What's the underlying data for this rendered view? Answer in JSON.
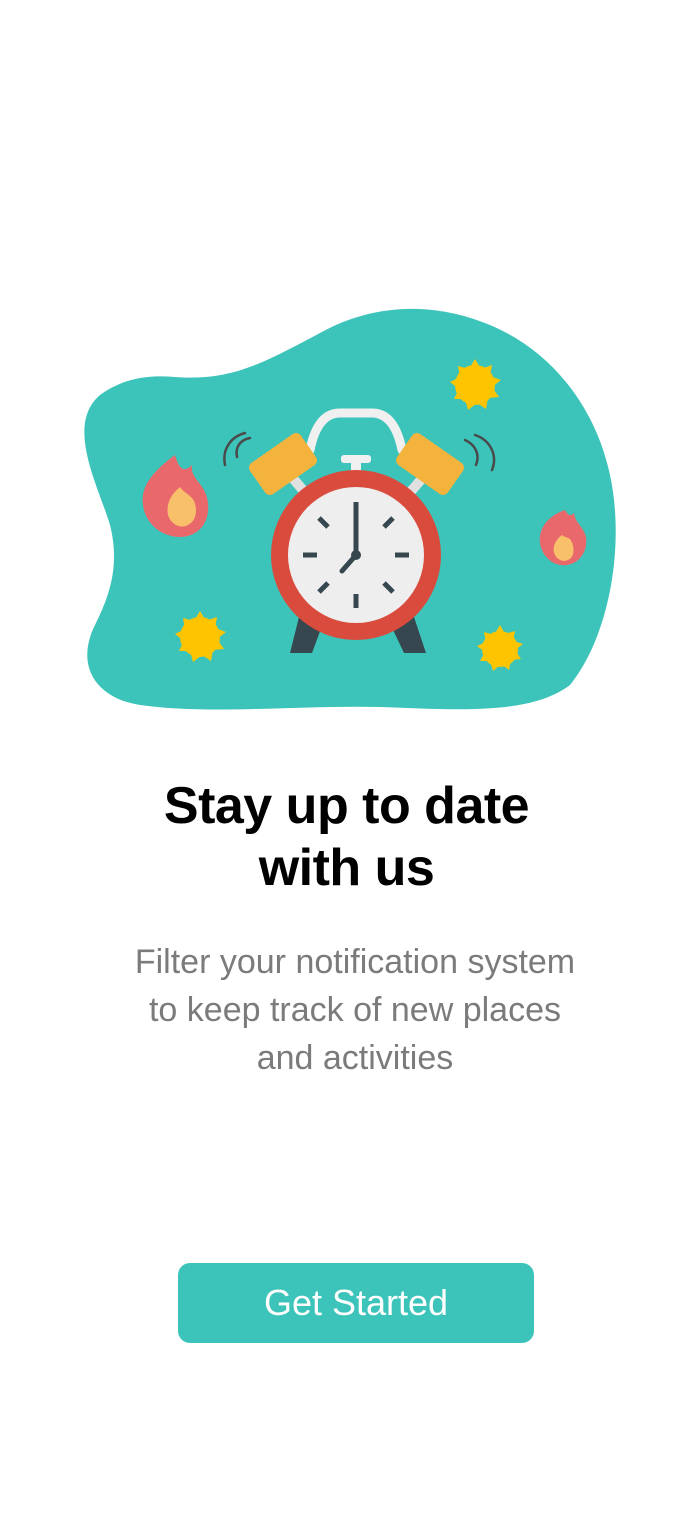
{
  "onboarding": {
    "title_line1": "Stay up to date",
    "title_line2": "with us",
    "subtitle_line1": "Filter your notification system",
    "subtitle_line2": "to keep track of new places",
    "subtitle_line3": "and activities",
    "button_label": "Get Started"
  },
  "colors": {
    "accent": "#3cc4ba",
    "blob": "#3cc4ba",
    "clock_ring": "#d94c3d",
    "clock_face": "#eeeeee",
    "bells": "#f3b33d",
    "sparkles": "#ffc400",
    "flames": "#e9686b",
    "flame_core": "#f8c06b",
    "title_text": "#000000",
    "subtitle_text": "#7b7b7b"
  },
  "icons": {
    "illustration": "alarm-clock-illustration"
  }
}
